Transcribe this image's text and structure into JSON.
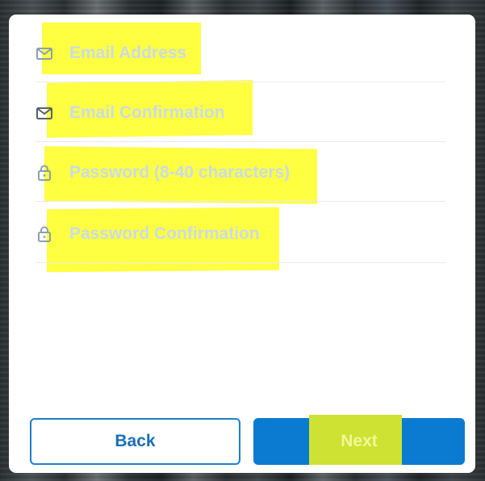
{
  "form": {
    "fields": [
      {
        "placeholder": "Email Address",
        "icon": "envelope-icon"
      },
      {
        "placeholder": "Email Confirmation",
        "icon": "envelope-icon"
      },
      {
        "placeholder": "Password (8-40 characters)",
        "icon": "lock-icon"
      },
      {
        "placeholder": "Password Confirmation",
        "icon": "lock-icon"
      }
    ]
  },
  "buttons": {
    "back_label": "Back",
    "next_label": "Next"
  },
  "colors": {
    "primary": "#0a7bd1",
    "placeholder_text": "#c9dbe8",
    "highlight": "#ffff2e",
    "highlight_on_button": "#cde232"
  }
}
